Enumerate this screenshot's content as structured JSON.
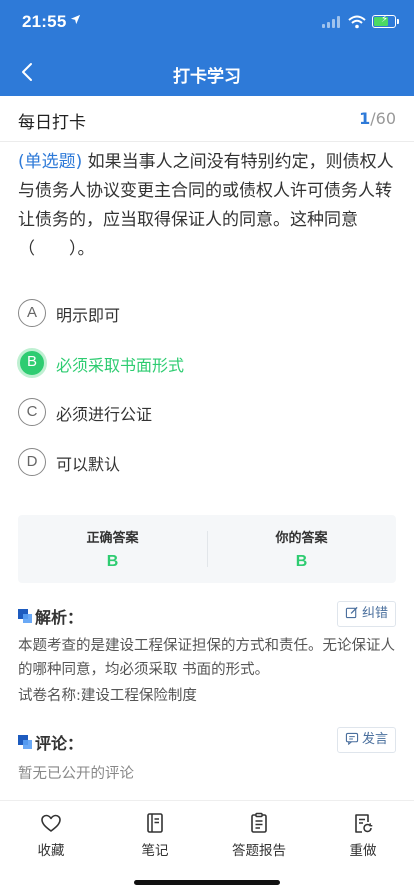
{
  "status": {
    "time": "21:55"
  },
  "nav": {
    "title": "打卡学习"
  },
  "title_row": {
    "title": "每日打卡",
    "current": "1",
    "separator": "/",
    "total": "60"
  },
  "question": {
    "type": "(单选题)",
    "text": "如果当事人之间没有特别约定，则债权人与债务人协议变更主合同的或债权人许可债务人转让债务的，应当取得保证人的同意。这种同意（　　）。"
  },
  "options": [
    {
      "letter": "A",
      "text": "明示即可"
    },
    {
      "letter": "B",
      "text": "必须采取书面形式"
    },
    {
      "letter": "C",
      "text": "必须进行公证"
    },
    {
      "letter": "D",
      "text": "可以默认"
    }
  ],
  "answer": {
    "correct_label": "正确答案",
    "correct_value": "B",
    "yours_label": "你的答案",
    "yours_value": "B"
  },
  "analysis": {
    "title": "解析：",
    "action": "纠错",
    "text": "本题考查的是建设工程保证担保的方式和责任。无论保证人的哪种同意，均必须采取 书面的形式。",
    "paper": "试卷名称:建设工程保险制度"
  },
  "comments": {
    "title": "评论：",
    "action": "发言",
    "empty": "暂无已公开的评论"
  },
  "tabbar": {
    "favorite": "收藏",
    "notes": "笔记",
    "report": "答题报告",
    "redo": "重做"
  },
  "colors": {
    "header": "#2e7ad8",
    "correct": "#2ecc71",
    "accent": "#2e7ad8"
  }
}
